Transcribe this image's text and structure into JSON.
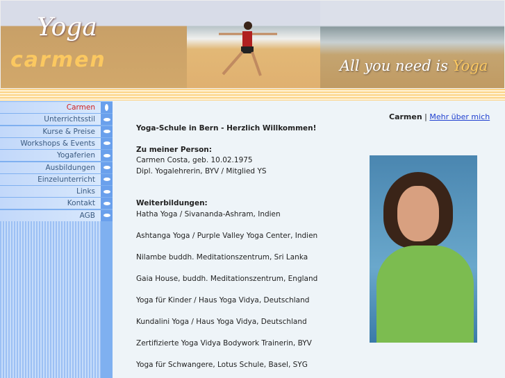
{
  "banner": {
    "logo_top": "Yoga",
    "logo_bottom": "carmen",
    "slogan": "All you need is",
    "slogan_accent": "Yoga"
  },
  "nav": {
    "items": [
      {
        "label": "Carmen",
        "active": true
      },
      {
        "label": "Unterrichtsstil"
      },
      {
        "label": "Kurse & Preise"
      },
      {
        "label": "Workshops & Events"
      },
      {
        "label": "Yogaferien"
      },
      {
        "label": "Ausbildungen"
      },
      {
        "label": "Einzelunterricht"
      },
      {
        "label": "Links"
      },
      {
        "label": "Kontakt"
      },
      {
        "label": "AGB"
      }
    ]
  },
  "top": {
    "name": "Carmen",
    "sep": " | ",
    "link": "Mehr über mich"
  },
  "main": {
    "welcome": "Yoga-Schule in Bern - Herzlich Willkommen!",
    "person_heading": "Zu meiner Person:",
    "person_lines": [
      "Carmen Costa, geb. 10.02.1975",
      "Dipl. Yogalehrerin, BYV / Mitglied YS"
    ],
    "training_heading": "Weiterbildungen:",
    "trainings": [
      "Hatha Yoga / Sivananda-Ashram, Indien",
      "Ashtanga Yoga / Purple Valley Yoga Center, Indien",
      "Nilambe buddh. Meditationszentrum, Sri Lanka",
      "Gaia House, buddh. Meditationszentrum, England",
      "Yoga für Kinder /  Haus Yoga Vidya, Deutschland",
      "Kundalini Yoga / Haus Yoga Vidya, Deutschland",
      "Zertifizierte Yoga Vidya Bodywork Trainerin, BYV",
      "Yoga für Schwangere, Lotus Schule, Basel, SYG"
    ]
  }
}
